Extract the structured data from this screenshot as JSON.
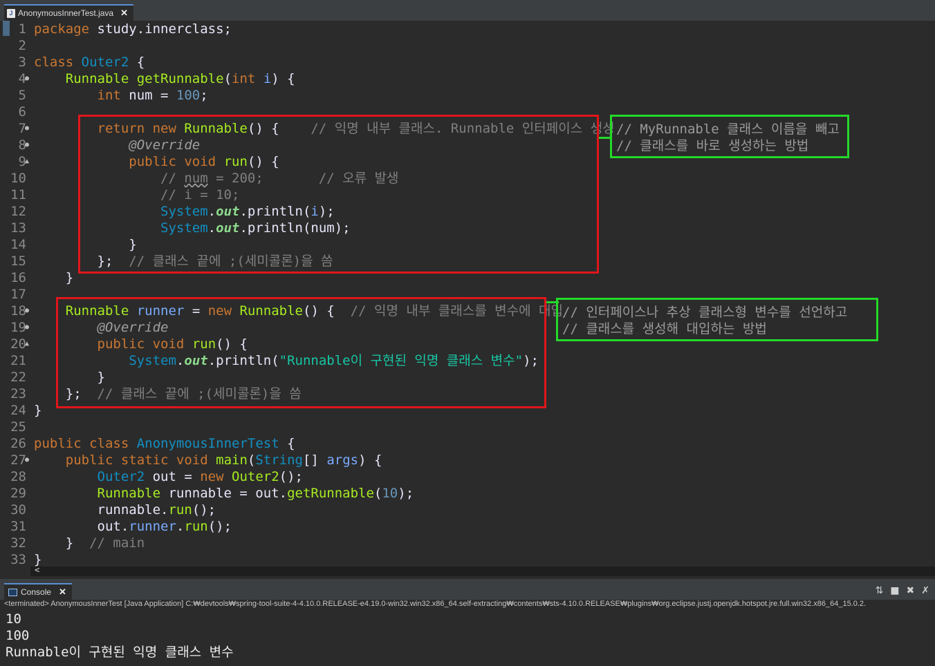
{
  "editor_tab": {
    "icon": "java-file-icon",
    "title": "AnonymousInnerTest.java",
    "close": "✕"
  },
  "lines": [
    {
      "n": "1",
      "segs": [
        [
          "kw",
          "package"
        ],
        [
          "pl",
          " study.innerclass;"
        ]
      ]
    },
    {
      "n": "2",
      "segs": []
    },
    {
      "n": "3",
      "segs": [
        [
          "kw",
          "class"
        ],
        [
          "pl",
          " "
        ],
        [
          "cl",
          "Outer2"
        ],
        [
          "pl",
          " {"
        ]
      ]
    },
    {
      "n": "4",
      "fold": "●",
      "segs": [
        [
          "pl",
          "    "
        ],
        [
          "tp",
          "Runnable"
        ],
        [
          "pl",
          " "
        ],
        [
          "fn",
          "getRunnable"
        ],
        [
          "pl",
          "("
        ],
        [
          "kw",
          "int"
        ],
        [
          "pl",
          " "
        ],
        [
          "var",
          "i"
        ],
        [
          "pl",
          ") {"
        ]
      ]
    },
    {
      "n": "5",
      "segs": [
        [
          "pl",
          "        "
        ],
        [
          "kw",
          "int"
        ],
        [
          "pl",
          " num = "
        ],
        [
          "num",
          "100"
        ],
        [
          "pl",
          ";"
        ]
      ]
    },
    {
      "n": "6",
      "segs": []
    },
    {
      "n": "7",
      "fold": "●",
      "segs": [
        [
          "pl",
          "        "
        ],
        [
          "kw",
          "return new"
        ],
        [
          "pl",
          " "
        ],
        [
          "tp",
          "Runnable"
        ],
        [
          "pl",
          "() {    "
        ],
        [
          "cm",
          "// 익명 내부 클래스. Runnable 인터페이스 생성"
        ]
      ]
    },
    {
      "n": "8",
      "fold": "●",
      "segs": [
        [
          "pl",
          "            "
        ],
        [
          "an",
          "@Override"
        ]
      ]
    },
    {
      "n": "9",
      "fold": "▲",
      "segs": [
        [
          "pl",
          "            "
        ],
        [
          "kw",
          "public void"
        ],
        [
          "pl",
          " "
        ],
        [
          "fn",
          "run"
        ],
        [
          "pl",
          "() {"
        ]
      ]
    },
    {
      "n": "10",
      "segs": [
        [
          "pl",
          "                "
        ],
        [
          "cm",
          "// "
        ],
        [
          "cm wv",
          "num"
        ],
        [
          "cm",
          " = 200;       // 오류 발생"
        ]
      ]
    },
    {
      "n": "11",
      "segs": [
        [
          "pl",
          "                "
        ],
        [
          "cm",
          "// i = 10;"
        ]
      ]
    },
    {
      "n": "12",
      "segs": [
        [
          "pl",
          "                "
        ],
        [
          "cl",
          "System"
        ],
        [
          "pl",
          "."
        ],
        [
          "fi",
          "out"
        ],
        [
          "pl",
          ".println("
        ],
        [
          "var",
          "i"
        ],
        [
          "pl",
          ");"
        ]
      ]
    },
    {
      "n": "13",
      "segs": [
        [
          "pl",
          "                "
        ],
        [
          "cl",
          "System"
        ],
        [
          "pl",
          "."
        ],
        [
          "fi",
          "out"
        ],
        [
          "pl",
          ".println(num);"
        ]
      ]
    },
    {
      "n": "14",
      "segs": [
        [
          "pl",
          "            }"
        ]
      ]
    },
    {
      "n": "15",
      "segs": [
        [
          "pl",
          "        };  "
        ],
        [
          "cm",
          "// 클래스 끝에 ;(세미콜론)을 씀"
        ]
      ]
    },
    {
      "n": "16",
      "segs": [
        [
          "pl",
          "    }"
        ]
      ]
    },
    {
      "n": "17",
      "segs": []
    },
    {
      "n": "18",
      "fold": "●",
      "segs": [
        [
          "pl",
          "    "
        ],
        [
          "tp",
          "Runnable"
        ],
        [
          "pl",
          " "
        ],
        [
          "var",
          "runner"
        ],
        [
          "pl",
          " = "
        ],
        [
          "kw",
          "new"
        ],
        [
          "pl",
          " "
        ],
        [
          "tp",
          "Runnable"
        ],
        [
          "pl",
          "() {  "
        ],
        [
          "cm",
          "// 익명 내부 클래스를 변수에 대입"
        ]
      ]
    },
    {
      "n": "19",
      "fold": "●",
      "segs": [
        [
          "pl",
          "        "
        ],
        [
          "an",
          "@Override"
        ]
      ]
    },
    {
      "n": "20",
      "fold": "▲",
      "segs": [
        [
          "pl",
          "        "
        ],
        [
          "kw",
          "public void"
        ],
        [
          "pl",
          " "
        ],
        [
          "fn",
          "run"
        ],
        [
          "pl",
          "() {"
        ]
      ]
    },
    {
      "n": "21",
      "segs": [
        [
          "pl",
          "            "
        ],
        [
          "cl",
          "System"
        ],
        [
          "pl",
          "."
        ],
        [
          "fi",
          "out"
        ],
        [
          "pl",
          ".println("
        ],
        [
          "st",
          "\"Runnable이 구현된 익명 클래스 변수\""
        ],
        [
          "pl",
          ");"
        ]
      ]
    },
    {
      "n": "22",
      "segs": [
        [
          "pl",
          "        }"
        ]
      ]
    },
    {
      "n": "23",
      "segs": [
        [
          "pl",
          "    };  "
        ],
        [
          "cm",
          "// 클래스 끝에 ;(세미콜론)을 씀"
        ]
      ]
    },
    {
      "n": "24",
      "segs": [
        [
          "pl",
          "}"
        ]
      ]
    },
    {
      "n": "25",
      "segs": []
    },
    {
      "n": "26",
      "segs": [
        [
          "kw",
          "public class"
        ],
        [
          "pl",
          " "
        ],
        [
          "cl",
          "AnonymousInnerTest"
        ],
        [
          "pl",
          " {"
        ]
      ]
    },
    {
      "n": "27",
      "fold": "●",
      "segs": [
        [
          "pl",
          "    "
        ],
        [
          "kw",
          "public static void"
        ],
        [
          "pl",
          " "
        ],
        [
          "fn",
          "main"
        ],
        [
          "pl",
          "("
        ],
        [
          "cl",
          "String"
        ],
        [
          "pl",
          "[] "
        ],
        [
          "var",
          "args"
        ],
        [
          "pl",
          ") {"
        ]
      ]
    },
    {
      "n": "28",
      "segs": [
        [
          "pl",
          "        "
        ],
        [
          "cl",
          "Outer2"
        ],
        [
          "pl",
          " out = "
        ],
        [
          "kw",
          "new"
        ],
        [
          "pl",
          " "
        ],
        [
          "tp",
          "Outer2"
        ],
        [
          "pl",
          "();"
        ]
      ]
    },
    {
      "n": "29",
      "segs": [
        [
          "pl",
          "        "
        ],
        [
          "tp",
          "Runnable"
        ],
        [
          "pl",
          " runnable = out."
        ],
        [
          "fn",
          "getRunnable"
        ],
        [
          "pl",
          "("
        ],
        [
          "num",
          "10"
        ],
        [
          "pl",
          ");"
        ]
      ]
    },
    {
      "n": "30",
      "segs": [
        [
          "pl",
          "        runnable."
        ],
        [
          "fn",
          "run"
        ],
        [
          "pl",
          "();"
        ]
      ]
    },
    {
      "n": "31",
      "segs": [
        [
          "pl",
          "        out."
        ],
        [
          "var",
          "runner"
        ],
        [
          "pl",
          "."
        ],
        [
          "fn",
          "run"
        ],
        [
          "pl",
          "();"
        ]
      ]
    },
    {
      "n": "32",
      "segs": [
        [
          "pl",
          "    }  "
        ],
        [
          "cm",
          "// main"
        ]
      ]
    },
    {
      "n": "33",
      "segs": [
        [
          "pl",
          "}"
        ]
      ]
    }
  ],
  "annotations": {
    "box1_note": [
      "// MyRunnable 클래스 이름을 빼고",
      "// 클래스를 바로 생성하는 방법"
    ],
    "box2_note": [
      "// 인터페이스나 추상 클래스형 변수를 선언하고",
      "// 클래스를 생성해 대입하는 방법"
    ],
    "colors": {
      "red": "#e0161a",
      "green": "#24d82a"
    }
  },
  "scroll_indicator": "<",
  "console": {
    "tab_label": "Console",
    "close": "✕",
    "tool_icons": [
      "pin-icon",
      "terminate-icon",
      "remove-launch-icon",
      "remove-all-icon"
    ],
    "status": "<terminated> AnonymousInnerTest [Java Application] C:₩devtools₩spring-tool-suite-4-4.10.0.RELEASE-e4.19.0-win32.win32.x86_64.self-extracting₩contents₩sts-4.10.0.RELEASE₩plugins₩org.eclipse.justj.openjdk.hotspot.jre.full.win32.x86_64_15.0.2.",
    "output": [
      "10",
      "100",
      "Runnable이 구현된 익명 클래스 변수"
    ]
  }
}
